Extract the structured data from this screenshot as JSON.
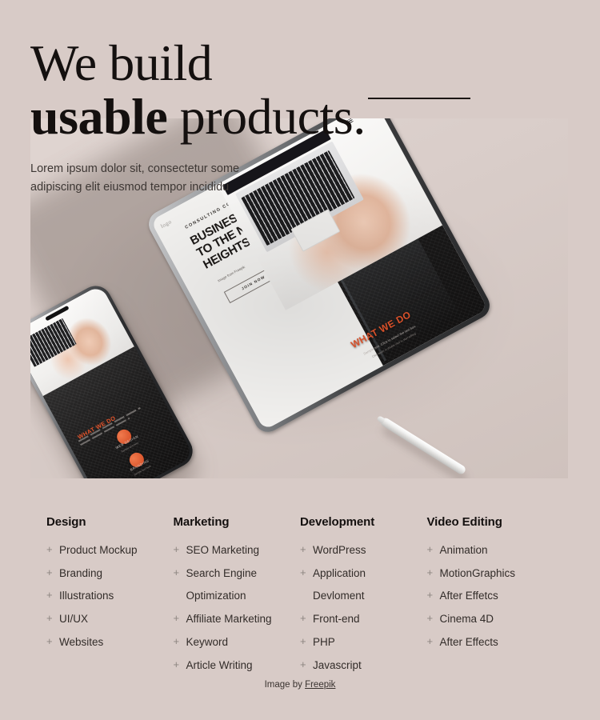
{
  "theme": {
    "page_bg": "#d8cbc7",
    "panel_bg": "#ddd2ce",
    "text_dark": "#14100f",
    "text_body": "#322c29",
    "accent_orange": "#e4552c",
    "plus_gray": "#8d8580"
  },
  "hero": {
    "headline_line1": "We build",
    "headline_bold": "usable",
    "headline_rest": " products.",
    "subhead": "Lorem ipsum dolor sit, consectetur some adipiscing elit eiusmod tempor incididu",
    "rule": "horizontal-rule-decoration"
  },
  "mockup": {
    "tablet": {
      "logo": "logo",
      "kicker": "CONSULTING COMPANY",
      "heading": "BUSINESS TAKEN TO THE NEW HEIGHTS",
      "sub": "Image from Freepik",
      "button": "JOIN NOW",
      "section_title": "WHAT WE DO",
      "sample_text": "Sample text. Click to select the text box.",
      "sample_text2": "Click again or double click to start editing",
      "menu_icon": "hamburger-menu-icon"
    },
    "phone": {
      "section_title": "WHAT WE DO",
      "item1_caption": "WEB DESIGN",
      "item1_sub": "Sample text here",
      "item2_caption": "BRANDING",
      "item2_sub": "Sample text here"
    },
    "stylus": "stylus-pen"
  },
  "columns": [
    {
      "title": "Design",
      "items": [
        {
          "label": "Product Mockup",
          "plus": "+"
        },
        {
          "label": "Branding",
          "plus": "+"
        },
        {
          "label": "Illustrations",
          "plus": "+"
        },
        {
          "label": "UI/UX",
          "plus": "+"
        },
        {
          "label": "Websites",
          "plus": "+"
        }
      ]
    },
    {
      "title": "Marketing",
      "items": [
        {
          "label": "SEO Marketing",
          "plus": "+"
        },
        {
          "label": "Search Engine",
          "plus": "+"
        },
        {
          "label": "Optimization",
          "plus": ""
        },
        {
          "label": "Affiliate Marketing",
          "plus": "+"
        },
        {
          "label": "Keyword",
          "plus": "+"
        },
        {
          "label": "Article Writing",
          "plus": "+"
        }
      ]
    },
    {
      "title": "Development",
      "items": [
        {
          "label": "WordPress",
          "plus": "+"
        },
        {
          "label": "Application",
          "plus": "+"
        },
        {
          "label": "Devloment",
          "plus": ""
        },
        {
          "label": "Front-end",
          "plus": "+"
        },
        {
          "label": "PHP",
          "plus": "+"
        },
        {
          "label": "Javascript",
          "plus": "+"
        }
      ]
    },
    {
      "title": "Video Editing",
      "items": [
        {
          "label": "Animation",
          "plus": "+"
        },
        {
          "label": "MotionGraphics",
          "plus": "+"
        },
        {
          "label": "After Effetcs",
          "plus": "+"
        },
        {
          "label": "Cinema 4D",
          "plus": "+"
        },
        {
          "label": "After Effects",
          "plus": "+"
        }
      ]
    }
  ],
  "credit": {
    "prefix": "Image by ",
    "link": "Freepik"
  }
}
